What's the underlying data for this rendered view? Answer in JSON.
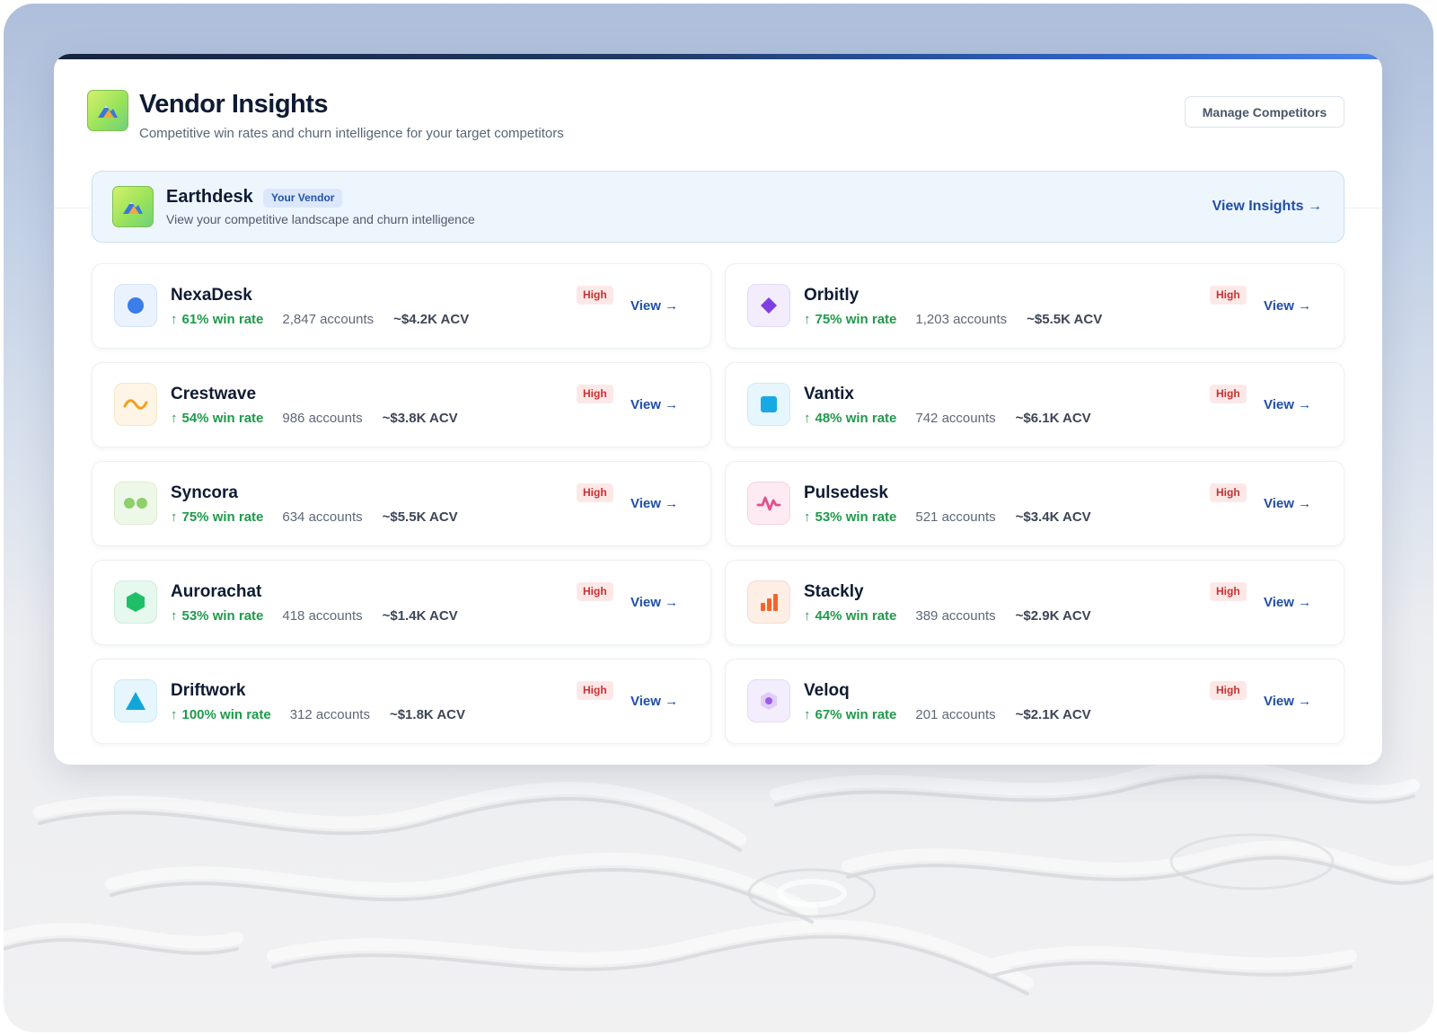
{
  "header": {
    "title": "Vendor Insights",
    "subtitle": "Competitive win rates and churn intelligence for your target competitors",
    "manage_button": "Manage Competitors",
    "brand_icon": "mountain-logo-icon"
  },
  "vendor": {
    "name": "Earthdesk",
    "tag": "Your Vendor",
    "description": "View your competitive landscape and churn intelligence",
    "cta": "View Insights →",
    "icon": "mountain-logo-icon"
  },
  "competitors": [
    {
      "name": "NexaDesk",
      "win_rate": "61% win rate",
      "accounts": "2,847 accounts",
      "acv": "~$4.2K ACV",
      "badge": "High",
      "link": "View →",
      "icon": "circle-icon",
      "color": "#3b7de9",
      "bg": "#eaf2fd",
      "border": "#d3e3f9"
    },
    {
      "name": "Orbitly",
      "win_rate": "75% win rate",
      "accounts": "1,203 accounts",
      "acv": "~$5.5K ACV",
      "badge": "High",
      "link": "View →",
      "icon": "diamond-icon",
      "color": "#7e3fe0",
      "bg": "#f2ecfd",
      "border": "#e3d8f8"
    },
    {
      "name": "Crestwave",
      "win_rate": "54% win rate",
      "accounts": "986 accounts",
      "acv": "~$3.8K ACV",
      "badge": "High",
      "link": "View →",
      "icon": "wave-icon",
      "color": "#f0a020",
      "bg": "#fef5e6",
      "border": "#f8e6c6"
    },
    {
      "name": "Vantix",
      "win_rate": "48% win rate",
      "accounts": "742 accounts",
      "acv": "~$6.1K ACV",
      "badge": "High",
      "link": "View →",
      "icon": "square-icon",
      "color": "#17a9e3",
      "bg": "#e7f6fd",
      "border": "#cdebf8"
    },
    {
      "name": "Syncora",
      "win_rate": "75% win rate",
      "accounts": "634 accounts",
      "acv": "~$5.5K ACV",
      "badge": "High",
      "link": "View →",
      "icon": "two-dots-icon",
      "color": "#8fcf6e",
      "bg": "#eef8e8",
      "border": "#dbeecd"
    },
    {
      "name": "Pulsedesk",
      "win_rate": "53% win rate",
      "accounts": "521 accounts",
      "acv": "~$3.4K ACV",
      "badge": "High",
      "link": "View →",
      "icon": "pulse-icon",
      "color": "#e64d8c",
      "bg": "#fdeaf2",
      "border": "#f7d3e2"
    },
    {
      "name": "Aurorachat",
      "win_rate": "53% win rate",
      "accounts": "418 accounts",
      "acv": "~$1.4K ACV",
      "badge": "High",
      "link": "View →",
      "icon": "hexagon-icon",
      "color": "#1fbf68",
      "bg": "#e7f8ee",
      "border": "#cdeedb"
    },
    {
      "name": "Stackly",
      "win_rate": "44% win rate",
      "accounts": "389 accounts",
      "acv": "~$2.9K ACV",
      "badge": "High",
      "link": "View →",
      "icon": "bar-chart-icon",
      "color": "#f2652e",
      "bg": "#fdeee6",
      "border": "#f8dcce"
    },
    {
      "name": "Driftwork",
      "win_rate": "100% win rate",
      "accounts": "312 accounts",
      "acv": "~$1.8K ACV",
      "badge": "High",
      "link": "View →",
      "icon": "triangle-icon",
      "color": "#12a6d8",
      "bg": "#e6f6fc",
      "border": "#cbeaf6"
    },
    {
      "name": "Veloq",
      "win_rate": "67% win rate",
      "accounts": "201 accounts",
      "acv": "~$2.1K ACV",
      "badge": "High",
      "link": "View →",
      "icon": "hexagon-dot-icon",
      "color": "#9a5be6",
      "bg": "#f3edfd",
      "border": "#e5d9f8"
    }
  ]
}
